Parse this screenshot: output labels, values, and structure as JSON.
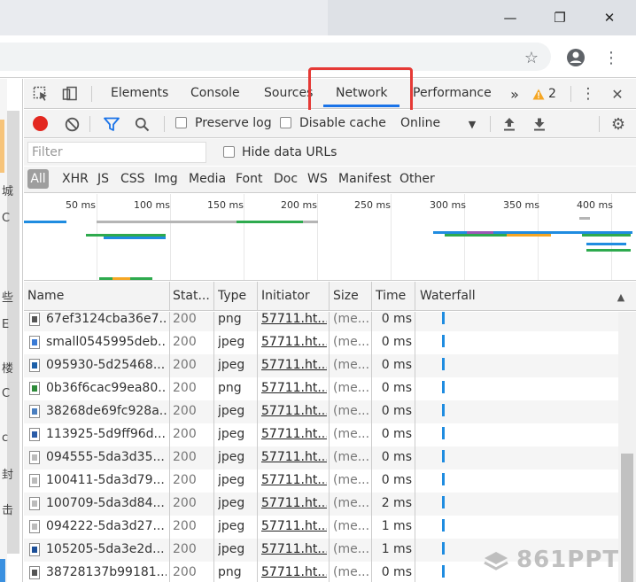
{
  "devtools": {
    "tabs": [
      {
        "label": "Elements"
      },
      {
        "label": "Console"
      },
      {
        "label": "Sources"
      },
      {
        "label": "Network",
        "active": true
      },
      {
        "label": "Performance"
      }
    ],
    "warning_count": "2",
    "toolbar": {
      "preserve_log": "Preserve log",
      "disable_cache": "Disable cache",
      "throttling": "Online"
    },
    "filter": {
      "placeholder": "Filter",
      "hide_data_urls": "Hide data URLs"
    },
    "type_filters": [
      "All",
      "XHR",
      "JS",
      "CSS",
      "Img",
      "Media",
      "Font",
      "Doc",
      "WS",
      "Manifest",
      "Other"
    ],
    "overview": {
      "ticks": [
        "50 ms",
        "100 ms",
        "150 ms",
        "200 ms",
        "250 ms",
        "300 ms",
        "350 ms",
        "400 ms"
      ]
    },
    "columns": [
      "Name",
      "Stat...",
      "Type",
      "Initiator",
      "Size",
      "Time",
      "Waterfall"
    ],
    "rows": [
      {
        "name": "67ef3124cba36e7...",
        "status": "200",
        "type": "png",
        "initiator": "57711.ht...",
        "size": "(me...",
        "time": "0 ms",
        "icon_color": "#555555"
      },
      {
        "name": "small0545995deb...",
        "status": "200",
        "type": "jpeg",
        "initiator": "57711.ht...",
        "size": "(me...",
        "time": "0 ms",
        "icon_color": "#3a7bd5"
      },
      {
        "name": "095930-5d25468...",
        "status": "200",
        "type": "jpeg",
        "initiator": "57711.ht...",
        "size": "(me...",
        "time": "0 ms",
        "icon_color": "#1c5fa8"
      },
      {
        "name": "0b36f6cac99ea80...",
        "status": "200",
        "type": "png",
        "initiator": "57711.ht...",
        "size": "(me...",
        "time": "0 ms",
        "icon_color": "#2e8b3a"
      },
      {
        "name": "38268de69fc928a...",
        "status": "200",
        "type": "jpeg",
        "initiator": "57711.ht...",
        "size": "(me...",
        "time": "0 ms",
        "icon_color": "#4a7fc0"
      },
      {
        "name": "113925-5d9ff96d...",
        "status": "200",
        "type": "jpeg",
        "initiator": "57711.ht...",
        "size": "(me...",
        "time": "0 ms",
        "icon_color": "#2a5ca8"
      },
      {
        "name": "094555-5da3d35...",
        "status": "200",
        "type": "jpeg",
        "initiator": "57711.ht...",
        "size": "(me...",
        "time": "0 ms",
        "icon_color": "#bbbbbb"
      },
      {
        "name": "100411-5da3d79...",
        "status": "200",
        "type": "jpeg",
        "initiator": "57711.ht...",
        "size": "(me...",
        "time": "0 ms",
        "icon_color": "#bbbbbb"
      },
      {
        "name": "100709-5da3d84...",
        "status": "200",
        "type": "jpeg",
        "initiator": "57711.ht...",
        "size": "(me...",
        "time": "2 ms",
        "icon_color": "#bbbbbb"
      },
      {
        "name": "094222-5da3d27...",
        "status": "200",
        "type": "jpeg",
        "initiator": "57711.ht...",
        "size": "(me...",
        "time": "1 ms",
        "icon_color": "#bbbbbb"
      },
      {
        "name": "105205-5da3e2d...",
        "status": "200",
        "type": "jpeg",
        "initiator": "57711.ht...",
        "size": "(me...",
        "time": "1 ms",
        "icon_color": "#1c4f98"
      },
      {
        "name": "38728137b99181...",
        "status": "200",
        "type": "png",
        "initiator": "57711.ht...",
        "size": "(me...",
        "time": "0 ms",
        "icon_color": "#555555"
      }
    ]
  },
  "page_strip_chars": [
    "城",
    "C",
    "些",
    "E",
    "楼",
    "C",
    "c",
    "封",
    "击"
  ],
  "watermark": "861PPT",
  "colors": {
    "accent": "#1a73e8",
    "record": "#e3271f",
    "highlight_box": "#e53935",
    "waterfall_bar": "#1f8ce0"
  }
}
